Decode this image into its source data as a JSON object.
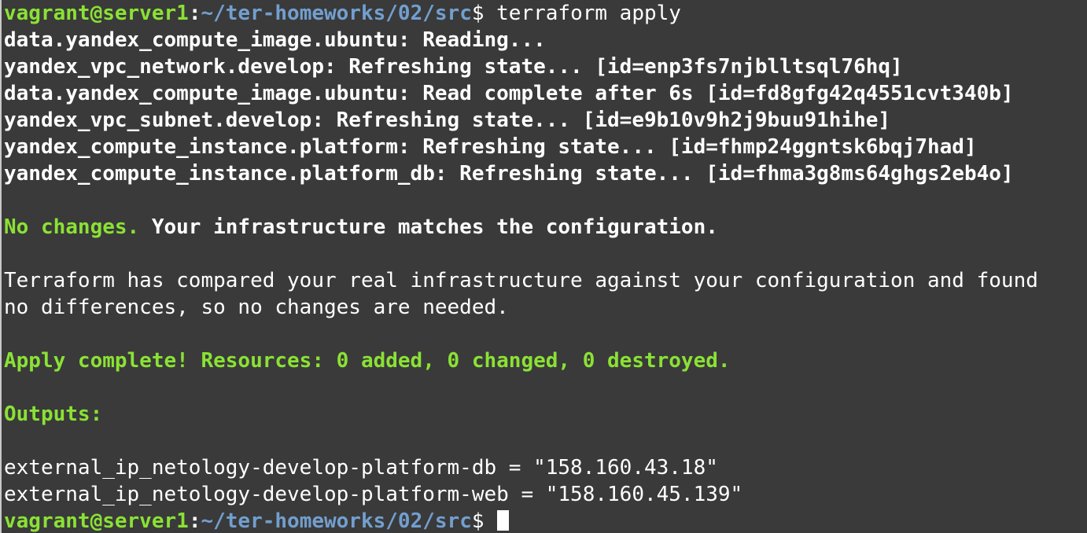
{
  "terminal": {
    "prompt_user_host": "vagrant@server1",
    "prompt_colon": ":",
    "prompt_path": "~/ter-homeworks/02/src",
    "prompt_symbol": "$",
    "command": " terraform apply",
    "refresh_lines": [
      "data.yandex_compute_image.ubuntu: Reading...",
      "yandex_vpc_network.develop: Refreshing state... [id=enp3fs7njblltsql76hq]",
      "data.yandex_compute_image.ubuntu: Read complete after 6s [id=fd8gfg42q4551cvt340b]",
      "yandex_vpc_subnet.develop: Refreshing state... [id=e9b10v9h2j9buu91hihe]",
      "yandex_compute_instance.platform: Refreshing state... [id=fhmp24ggntsk6bqj7had]",
      "yandex_compute_instance.platform_db: Refreshing state... [id=fhma3g8ms64ghgs2eb4o]"
    ],
    "no_changes_label": "No changes.",
    "no_changes_text": " Your infrastructure matches the configuration.",
    "compare_line_1": "Terraform has compared your real infrastructure against your configuration and found",
    "compare_line_2": "no differences, so no changes are needed.",
    "apply_complete": "Apply complete! Resources: 0 added, 0 changed, 0 destroyed.",
    "outputs_label": "Outputs:",
    "outputs": [
      "external_ip_netology-develop-platform-db = \"158.160.43.18\"",
      "external_ip_netology-develop-platform-web = \"158.160.45.139\""
    ]
  },
  "colors": {
    "background": "#3a3a3a",
    "green": "#8ae234",
    "path_blue": "#729fcf",
    "text": "#ffffff"
  }
}
